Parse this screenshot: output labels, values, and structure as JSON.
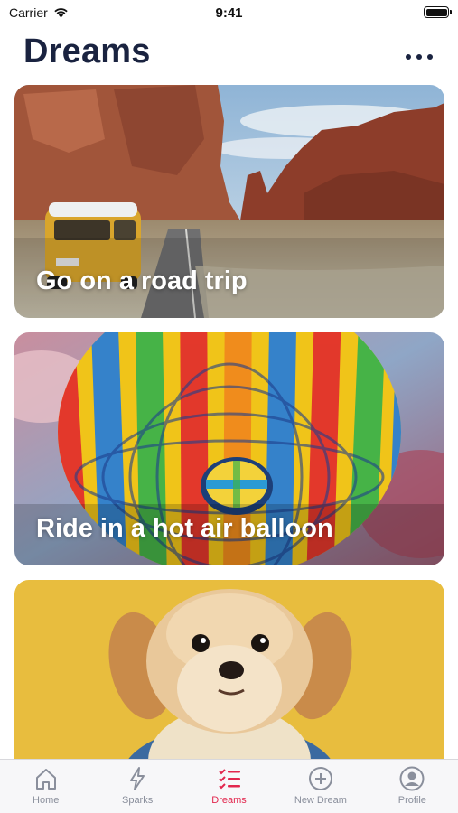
{
  "status_bar": {
    "carrier": "Carrier",
    "time": "9:41"
  },
  "header": {
    "title": "Dreams"
  },
  "cards": [
    {
      "title": "Go on a road trip"
    },
    {
      "title": "Ride in a hot air balloon"
    },
    {
      "title": ""
    }
  ],
  "tab_bar": {
    "items": [
      {
        "label": "Home",
        "icon": "house-icon",
        "active": false
      },
      {
        "label": "Sparks",
        "icon": "bolt-icon",
        "active": false
      },
      {
        "label": "Dreams",
        "icon": "checklist-icon",
        "active": true
      },
      {
        "label": "New Dream",
        "icon": "plus-circle-icon",
        "active": false
      },
      {
        "label": "Profile",
        "icon": "person-circle-icon",
        "active": false
      }
    ],
    "active_color": "#e2264d",
    "inactive_color": "#8a8f9c"
  }
}
